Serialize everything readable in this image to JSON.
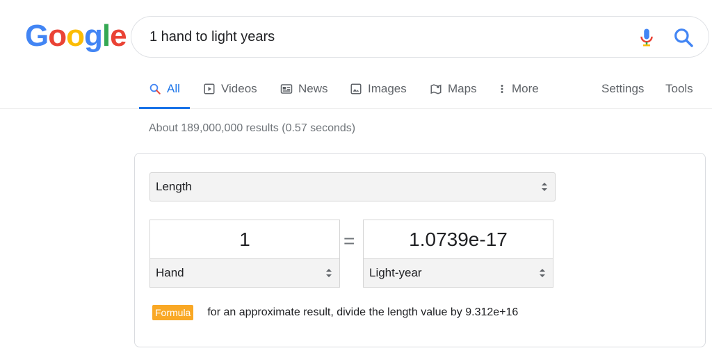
{
  "logo": {
    "letters": [
      "G",
      "o",
      "o",
      "g",
      "l",
      "e"
    ],
    "colors": [
      "#4285f4",
      "#ea4335",
      "#fbbc05",
      "#4285f4",
      "#34a853",
      "#ea4335"
    ]
  },
  "search": {
    "query": "1 hand to light years"
  },
  "tabs": [
    {
      "label": "All",
      "icon": "search-icon",
      "active": true
    },
    {
      "label": "Videos",
      "icon": "play-icon"
    },
    {
      "label": "News",
      "icon": "news-icon"
    },
    {
      "label": "Images",
      "icon": "image-icon"
    },
    {
      "label": "Maps",
      "icon": "map-icon"
    },
    {
      "label": "More",
      "icon": "more-vertical-icon"
    }
  ],
  "tools": {
    "settings": "Settings",
    "tools": "Tools"
  },
  "stats": "About 189,000,000 results (0.57 seconds)",
  "converter": {
    "category": "Length",
    "from_value": "1",
    "from_unit": "Hand",
    "equals": "=",
    "to_value": "1.0739e-17",
    "to_unit": "Light-year",
    "formula_label": "Formula",
    "formula_text": "for an approximate result, divide the length value by 9.312e+16"
  },
  "colors": {
    "accent": "#1a73e8",
    "formula_badge": "#f9a825",
    "muted": "#70757a"
  }
}
